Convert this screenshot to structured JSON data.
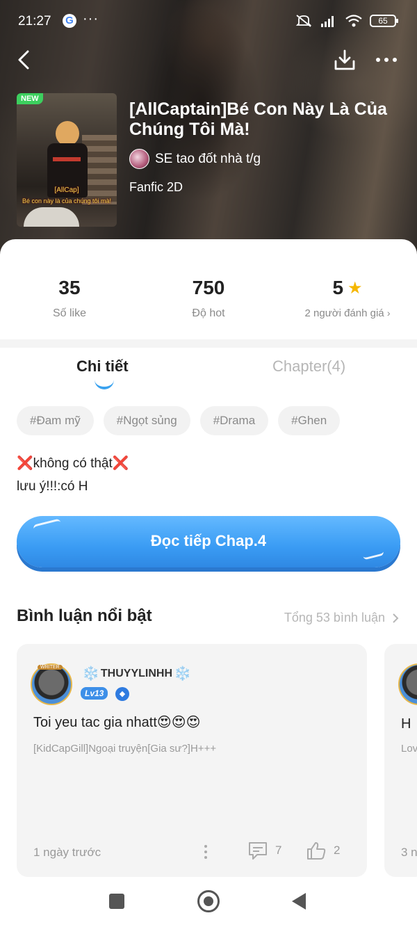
{
  "status_bar": {
    "time": "21:27",
    "google_letter": "G",
    "dots": "···",
    "battery": "65"
  },
  "book": {
    "badge": "NEW",
    "title": "[AllCaptain]Bé Con Này Là Của Chúng Tôi Mà!",
    "author": "SE tao đốt nhà t/g",
    "genre": "Fanfic 2D",
    "cover_text_line1": "[AllCap]",
    "cover_text_line2": "Bé con này là của chúng tôi mà!"
  },
  "stats": [
    {
      "value": "35",
      "label": "Số like"
    },
    {
      "value": "750",
      "label": "Độ hot"
    },
    {
      "value": "5",
      "label": "2 người đánh giá"
    }
  ],
  "tabs": {
    "active": "Chi tiết",
    "inactive": "Chapter(4)"
  },
  "tags": [
    "#Đam mỹ",
    "#Ngọt sủng",
    "#Drama",
    "#Ghen"
  ],
  "description": {
    "line1": "không có thật",
    "line2": "lưu ý!!!:có H",
    "mark": "❌"
  },
  "read_button": "Đọc tiếp Chap.4",
  "comments": {
    "title": "Bình luận nổi bật",
    "total": "Tổng 53 bình luận",
    "items": [
      {
        "avatar_tag": "WRITER",
        "snow": "❄️",
        "user": "THUYYLINHH",
        "level": "Lv13",
        "text": "Toi yeu tac gia nhatt😍😍😍",
        "reference": "[KidCapGill]Ngoại truyện[Gia sư?]H+++",
        "time": "1 ngày trước",
        "replies": "7",
        "likes": "2"
      },
      {
        "text_peek": "H",
        "sub_peek": "Lov",
        "time_peek": "3 n"
      }
    ]
  },
  "colors": {
    "accent": "#3a9cf4",
    "tag_bg": "#f2f2f2",
    "new_badge": "#3ccf5e",
    "star": "#f5b700"
  }
}
